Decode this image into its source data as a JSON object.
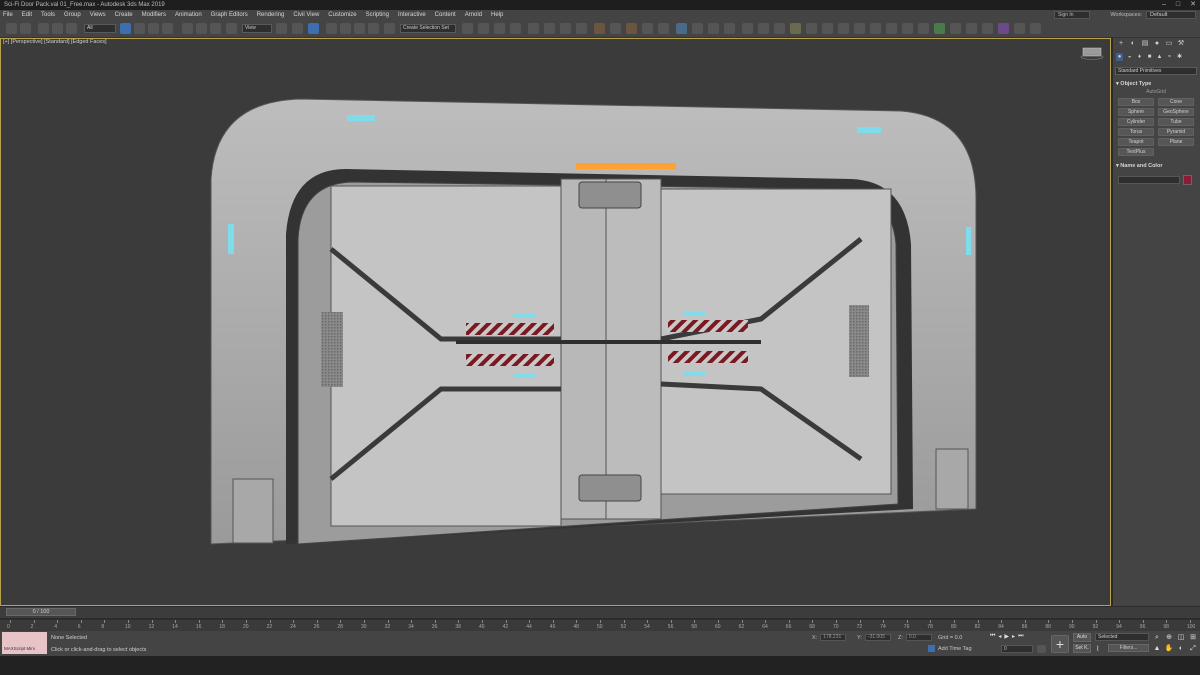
{
  "window": {
    "title": "Sci-Fi Door Pack.val 01_Free.max - Autodesk 3ds Max 2019",
    "controls": [
      "–",
      "□",
      "✕"
    ]
  },
  "menu": [
    "File",
    "Edit",
    "Tools",
    "Group",
    "Views",
    "Create",
    "Modifiers",
    "Animation",
    "Graph Editors",
    "Rendering",
    "Civil View",
    "Customize",
    "Scripting",
    "Interactive",
    "Content",
    "Arnold",
    "Help"
  ],
  "account": {
    "signin": "Sign In",
    "workspaces_label": "Workspaces:",
    "workspace": "Default"
  },
  "toolbar": {
    "filter_drop": "All",
    "refcoord_drop": "View",
    "selection_set": "Create Selection Set"
  },
  "viewport": {
    "label": "[+] [Perspective] [Standard] [Edged Faces]"
  },
  "command_panel": {
    "tabs": [
      "+",
      "◐",
      "▤",
      "●",
      "▭",
      "⚒"
    ],
    "dropdown": "Standard Primitives",
    "object_type_header": "▾ Object Type",
    "autogrid": "AutoGrid",
    "primitives": [
      "Box",
      "Cone",
      "Sphere",
      "GeoSphere",
      "Cylinder",
      "Tube",
      "Torus",
      "Pyramid",
      "Teapot",
      "Plane",
      "TextPlus"
    ],
    "name_color_header": "▾ Name and Color",
    "object_color": "#8a1c3a"
  },
  "timeline": {
    "frame_indicator": "0 / 100",
    "ticks": [
      "0",
      "2",
      "4",
      "6",
      "8",
      "10",
      "12",
      "14",
      "16",
      "18",
      "20",
      "22",
      "24",
      "26",
      "28",
      "30",
      "32",
      "34",
      "36",
      "38",
      "40",
      "42",
      "44",
      "46",
      "48",
      "50",
      "52",
      "54",
      "56",
      "58",
      "60",
      "62",
      "64",
      "66",
      "68",
      "70",
      "72",
      "74",
      "76",
      "78",
      "80",
      "82",
      "84",
      "86",
      "88",
      "90",
      "92",
      "94",
      "96",
      "98",
      "100"
    ]
  },
  "status": {
    "maxscript": "MAXScript Mini",
    "selection": "None Selected",
    "prompt": "Click or click-and-drag to select objects",
    "x_label": "X:",
    "x_value": "178.231",
    "y_label": "Y:",
    "y_value": "-31.005",
    "z_label": "Z:",
    "z_value": "0.0",
    "grid": "Grid = 0.0",
    "add_time_tag": "Add Time Tag",
    "frame": "0",
    "auto_key": "Auto",
    "set_key": "Set K.",
    "selected": "Selected",
    "filters": "Filters..."
  },
  "model": {
    "accent_orange": "#ffa030",
    "accent_cyan": "#7fdcea",
    "hazard_red": "#7a1a20"
  }
}
